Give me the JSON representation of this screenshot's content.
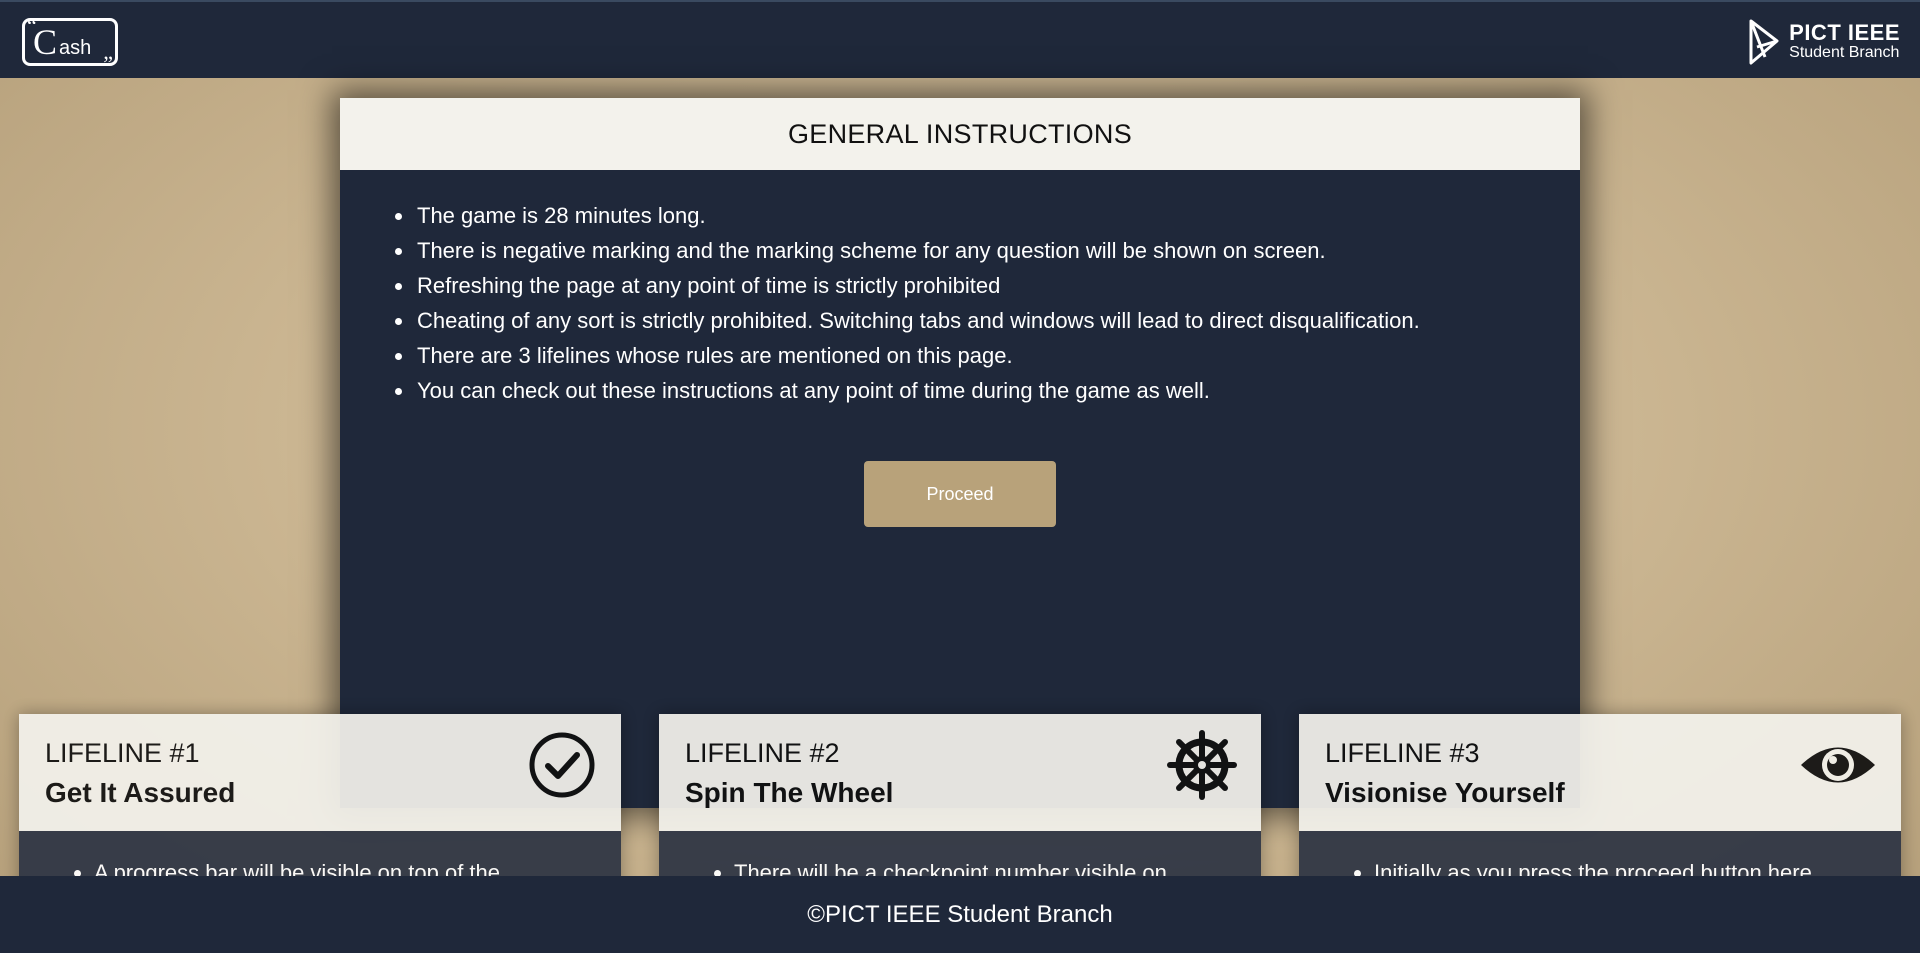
{
  "header": {
    "logo_left": {
      "big": "C",
      "small": "ash",
      "open_quote": "“",
      "close_quote": "”"
    },
    "logo_right": {
      "line1": "PICT IEEE",
      "line2": "Student Branch"
    }
  },
  "instructions": {
    "title": "GENERAL INSTRUCTIONS",
    "rules": [
      "The game is 28 minutes long.",
      "There is negative marking and the marking scheme for any question will be shown on screen.",
      "Refreshing the page at any point of time is strictly prohibited",
      "Cheating of any sort is strictly prohibited. Switching tabs and windows will lead to direct disqualification.",
      "There are 3 lifelines whose rules are mentioned on this page.",
      "You can check out these instructions at any point of time during the game as well."
    ],
    "proceed_label": "Proceed"
  },
  "lifelines": [
    {
      "number": "LIFELINE #1",
      "name": "Get It Assured",
      "icon": "check-circle-icon",
      "rule": "A progress bar will be visible on top of the"
    },
    {
      "number": "LIFELINE #2",
      "name": "Spin The Wheel",
      "icon": "ship-wheel-icon",
      "rule": "There will be a checkpoint number visible on"
    },
    {
      "number": "LIFELINE #3",
      "name": "Visionise Yourself",
      "icon": "eye-icon",
      "rule": "Initially as you press the proceed button here"
    }
  ],
  "footer": {
    "text": "©PICT IEEE Student Branch"
  },
  "colors": {
    "navy": "#1f283a",
    "accent": "#b8a27a",
    "card_light": "#f3f2ec",
    "card_body": "#2e3544"
  }
}
